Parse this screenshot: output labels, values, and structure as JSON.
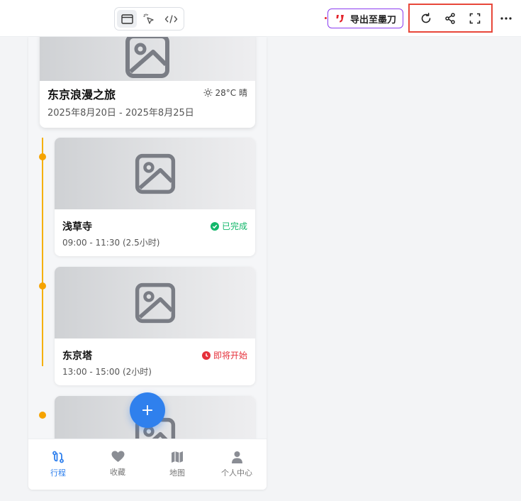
{
  "toolbar": {
    "modes": [
      {
        "name": "preview",
        "icon": "window-icon",
        "active": true
      },
      {
        "name": "select",
        "icon": "cursor-click-icon",
        "active": false
      },
      {
        "name": "code",
        "icon": "code-icon",
        "active": false
      }
    ],
    "export_label": "导出至墨刀",
    "actions": [
      "refresh-icon",
      "share-icon",
      "fullscreen-icon"
    ],
    "more_icon": "more-horizontal-icon",
    "highlight_color": "#e8473a",
    "export_border_color": "#8b3cf0"
  },
  "trip": {
    "title": "东京浪漫之旅",
    "weather": "28°C 晴",
    "dates": "2025年8月20日 - 2025年8月25日"
  },
  "timeline": {
    "color": "#f5a300",
    "items": [
      {
        "title": "浅草寺",
        "time": "09:00 - 11:30 (2.5小时)",
        "status": "已完成",
        "status_color": "#12b76a"
      },
      {
        "title": "东京塔",
        "time": "13:00 - 15:00 (2小时)",
        "status": "即将开始",
        "status_color": "#e5303a"
      }
    ]
  },
  "fab": {
    "label": "+",
    "color": "#2f80ed"
  },
  "tabbar": {
    "items": [
      {
        "label": "行程",
        "icon": "route-icon",
        "active": true
      },
      {
        "label": "收藏",
        "icon": "heart-icon",
        "active": false
      },
      {
        "label": "地图",
        "icon": "map-icon",
        "active": false
      },
      {
        "label": "个人中心",
        "icon": "user-icon",
        "active": false
      }
    ],
    "active_color": "#2f80ed"
  }
}
